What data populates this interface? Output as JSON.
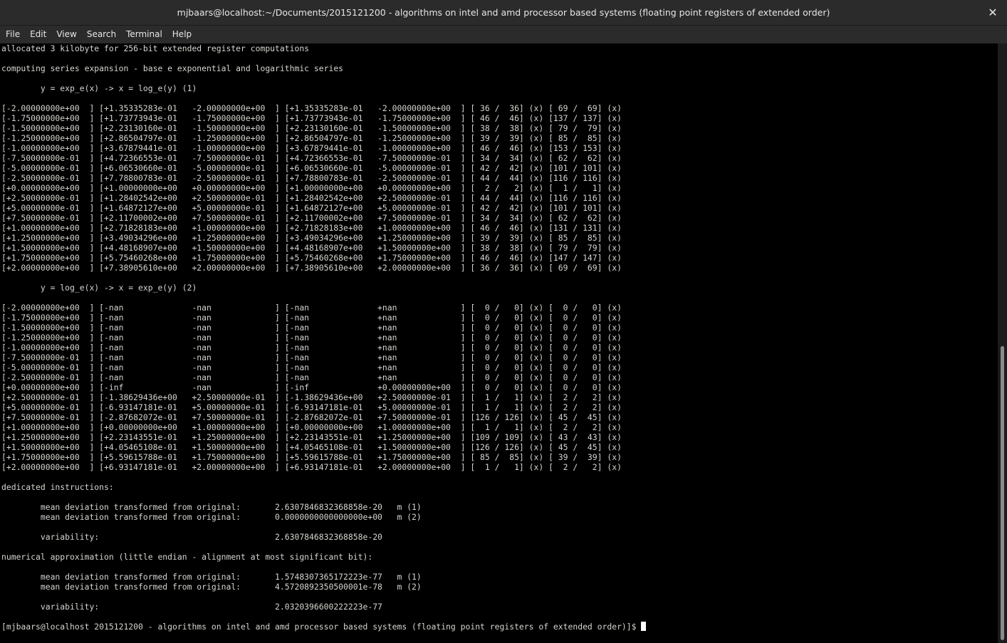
{
  "window": {
    "title": "mjbaars@localhost:~/Documents/2015121200 - algorithms on intel and amd processor based systems (floating point registers of extended order)",
    "close_glyph": "✕"
  },
  "menu": [
    "File",
    "Edit",
    "View",
    "Search",
    "Terminal",
    "Help"
  ],
  "terminal": {
    "lines": [
      "allocated 3 kilobyte for 256-bit extended register computations",
      "",
      "computing series expansion - base e exponential and logarithmic series",
      "",
      "        y = exp_e(x) -> x = log_e(y) (1)",
      "",
      "[-2.00000000e+00  ] [+1.35335283e-01   -2.00000000e+00  ] [+1.35335283e-01   -2.00000000e+00  ] [ 36 /  36] (x) [ 69 /  69] (x)",
      "[-1.75000000e+00  ] [+1.73773943e-01   -1.75000000e+00  ] [+1.73773943e-01   -1.75000000e+00  ] [ 46 /  46] (x) [137 / 137] (x)",
      "[-1.50000000e+00  ] [+2.23130160e-01   -1.50000000e+00  ] [+2.23130160e-01   -1.50000000e+00  ] [ 38 /  38] (x) [ 79 /  79] (x)",
      "[-1.25000000e+00  ] [+2.86504797e-01   -1.25000000e+00  ] [+2.86504797e-01   -1.25000000e+00  ] [ 39 /  39] (x) [ 85 /  85] (x)",
      "[-1.00000000e+00  ] [+3.67879441e-01   -1.00000000e+00  ] [+3.67879441e-01   -1.00000000e+00  ] [ 46 /  46] (x) [153 / 153] (x)",
      "[-7.50000000e-01  ] [+4.72366553e-01   -7.50000000e-01  ] [+4.72366553e-01   -7.50000000e-01  ] [ 34 /  34] (x) [ 62 /  62] (x)",
      "[-5.00000000e-01  ] [+6.06530660e-01   -5.00000000e-01  ] [+6.06530660e-01   -5.00000000e-01  ] [ 42 /  42] (x) [101 / 101] (x)",
      "[-2.50000000e-01  ] [+7.78800783e-01   -2.50000000e-01  ] [+7.78800783e-01   -2.50000000e-01  ] [ 44 /  44] (x) [116 / 116] (x)",
      "[+0.00000000e+00  ] [+1.00000000e+00   +0.00000000e+00  ] [+1.00000000e+00   +0.00000000e+00  ] [  2 /   2] (x) [  1 /   1] (x)",
      "[+2.50000000e-01  ] [+1.28402542e+00   +2.50000000e-01  ] [+1.28402542e+00   +2.50000000e-01  ] [ 44 /  44] (x) [116 / 116] (x)",
      "[+5.00000000e-01  ] [+1.64872127e+00   +5.00000000e-01  ] [+1.64872127e+00   +5.00000000e-01  ] [ 42 /  42] (x) [101 / 101] (x)",
      "[+7.50000000e-01  ] [+2.11700002e+00   +7.50000000e-01  ] [+2.11700002e+00   +7.50000000e-01  ] [ 34 /  34] (x) [ 62 /  62] (x)",
      "[+1.00000000e+00  ] [+2.71828183e+00   +1.00000000e+00  ] [+2.71828183e+00   +1.00000000e+00  ] [ 46 /  46] (x) [131 / 131] (x)",
      "[+1.25000000e+00  ] [+3.49034296e+00   +1.25000000e+00  ] [+3.49034296e+00   +1.25000000e+00  ] [ 39 /  39] (x) [ 85 /  85] (x)",
      "[+1.50000000e+00  ] [+4.48168907e+00   +1.50000000e+00  ] [+4.48168907e+00   +1.50000000e+00  ] [ 38 /  38] (x) [ 79 /  79] (x)",
      "[+1.75000000e+00  ] [+5.75460268e+00   +1.75000000e+00  ] [+5.75460268e+00   +1.75000000e+00  ] [ 46 /  46] (x) [147 / 147] (x)",
      "[+2.00000000e+00  ] [+7.38905610e+00   +2.00000000e+00  ] [+7.38905610e+00   +2.00000000e+00  ] [ 36 /  36] (x) [ 69 /  69] (x)",
      "",
      "        y = log_e(x) -> x = exp_e(y) (2)",
      "",
      "[-2.00000000e+00  ] [-nan              -nan             ] [-nan              +nan             ] [  0 /   0] (x) [  0 /   0] (x)",
      "[-1.75000000e+00  ] [-nan              -nan             ] [-nan              +nan             ] [  0 /   0] (x) [  0 /   0] (x)",
      "[-1.50000000e+00  ] [-nan              -nan             ] [-nan              +nan             ] [  0 /   0] (x) [  0 /   0] (x)",
      "[-1.25000000e+00  ] [-nan              -nan             ] [-nan              +nan             ] [  0 /   0] (x) [  0 /   0] (x)",
      "[-1.00000000e+00  ] [-nan              -nan             ] [-nan              +nan             ] [  0 /   0] (x) [  0 /   0] (x)",
      "[-7.50000000e-01  ] [-nan              -nan             ] [-nan              +nan             ] [  0 /   0] (x) [  0 /   0] (x)",
      "[-5.00000000e-01  ] [-nan              -nan             ] [-nan              +nan             ] [  0 /   0] (x) [  0 /   0] (x)",
      "[-2.50000000e-01  ] [-nan              -nan             ] [-nan              +nan             ] [  0 /   0] (x) [  0 /   0] (x)",
      "[+0.00000000e+00  ] [-inf              -nan             ] [-inf              +0.00000000e+00  ] [  0 /   0] (x) [  0 /   0] (x)",
      "[+2.50000000e-01  ] [-1.38629436e+00   +2.50000000e-01  ] [-1.38629436e+00   +2.50000000e-01  ] [  1 /   1] (x) [  2 /   2] (x)",
      "[+5.00000000e-01  ] [-6.93147181e-01   +5.00000000e-01  ] [-6.93147181e-01   +5.00000000e-01  ] [  1 /   1] (x) [  2 /   2] (x)",
      "[+7.50000000e-01  ] [-2.87682072e-01   +7.50000000e-01  ] [-2.87682072e-01   +7.50000000e-01  ] [126 / 126] (x) [ 45 /  45] (x)",
      "[+1.00000000e+00  ] [+0.00000000e+00   +1.00000000e+00  ] [+0.00000000e+00   +1.00000000e+00  ] [  1 /   1] (x) [  2 /   2] (x)",
      "[+1.25000000e+00  ] [+2.23143551e-01   +1.25000000e+00  ] [+2.23143551e-01   +1.25000000e+00  ] [109 / 109] (x) [ 43 /  43] (x)",
      "[+1.50000000e+00  ] [+4.05465108e-01   +1.50000000e+00  ] [+4.05465108e-01   +1.50000000e+00  ] [126 / 126] (x) [ 45 /  45] (x)",
      "[+1.75000000e+00  ] [+5.59615788e-01   +1.75000000e+00  ] [+5.59615788e-01   +1.75000000e+00  ] [ 85 /  85] (x) [ 39 /  39] (x)",
      "[+2.00000000e+00  ] [+6.93147181e-01   +2.00000000e+00  ] [+6.93147181e-01   +2.00000000e+00  ] [  1 /   1] (x) [  2 /   2] (x)",
      "",
      "dedicated instructions:",
      "",
      "        mean deviation transformed from original:       2.6307846832368858e-20   m (1)",
      "        mean deviation transformed from original:       0.0000000000000000e+00   m (2)",
      "",
      "        variability:                                    2.6307846832368858e-20",
      "",
      "numerical approximation (little endian - alignment at most significant bit):",
      "",
      "        mean deviation transformed from original:       1.5748307365172223e-77   m (1)",
      "        mean deviation transformed from original:       4.5720892350500001e-78   m (2)",
      "",
      "        variability:                                    2.0320396600222223e-77",
      ""
    ],
    "prompt": "[mjbaars@localhost 2015121200 - algorithms on intel and amd processor based systems (floating point registers of extended order)]$ "
  }
}
